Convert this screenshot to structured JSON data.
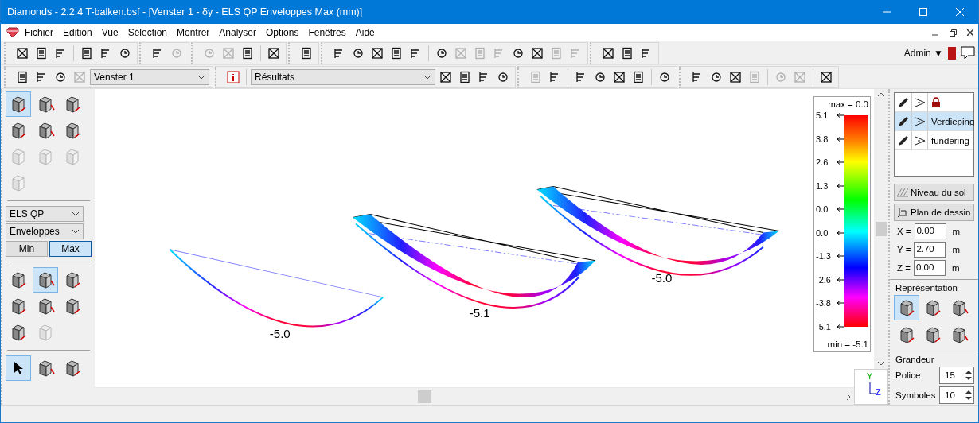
{
  "window": {
    "title": "Diamonds  -  2.2.4 T-balken.bsf - [Venster 1 - δy - ELS QP Enveloppes Max  (mm)]"
  },
  "menu": [
    {
      "label": "Fichier"
    },
    {
      "label": "Edition"
    },
    {
      "label": "Vue"
    },
    {
      "label": "Sélection"
    },
    {
      "label": "Montrer"
    },
    {
      "label": "Analyser"
    },
    {
      "label": "Options"
    },
    {
      "label": "Fenêtres"
    },
    {
      "label": "Aide"
    }
  ],
  "user": {
    "name": "Admin",
    "caret": "▼"
  },
  "toolbar_1": [
    [
      {
        "disabled": false
      },
      {
        "disabled": false
      },
      {
        "disabled": false
      }
    ],
    [
      {
        "disabled": false
      },
      {
        "disabled": false
      },
      {
        "disabled": false
      }
    ],
    [
      {
        "disabled": false
      },
      {
        "disabled": true
      }
    ],
    [
      {
        "disabled": true
      },
      {
        "disabled": true
      },
      {
        "disabled": false
      }
    ],
    [
      {
        "disabled": false
      }
    ],
    [
      {
        "disabled": false
      }
    ],
    [
      {
        "disabled": false
      },
      {
        "disabled": false
      },
      {
        "disabled": false
      },
      {
        "disabled": false
      },
      {
        "disabled": false
      }
    ],
    [
      {
        "disabled": false
      },
      {
        "disabled": true
      },
      {
        "disabled": true
      },
      {
        "disabled": true
      },
      {
        "disabled": false
      },
      {
        "disabled": false
      },
      {
        "disabled": true
      },
      {
        "disabled": true
      }
    ],
    [
      {
        "disabled": false
      },
      {
        "disabled": false
      },
      {
        "disabled": false
      }
    ]
  ],
  "toolbar_2": {
    "window_select": "Venster 1",
    "view_select": "Résultats",
    "groups_a": [
      [
        {
          "disabled": false
        },
        {
          "disabled": false
        },
        {
          "disabled": false
        },
        {
          "disabled": true
        }
      ]
    ],
    "groups_b": [
      [
        {
          "disabled": false
        },
        {
          "disabled": false
        },
        {
          "disabled": false
        },
        {
          "disabled": false
        }
      ],
      [
        {
          "disabled": true
        },
        {
          "disabled": false
        }
      ],
      [
        {
          "disabled": false
        },
        {
          "disabled": false
        },
        {
          "disabled": false
        },
        {
          "disabled": false
        }
      ],
      [
        {
          "disabled": false
        }
      ],
      [
        {
          "disabled": false
        },
        {
          "disabled": false
        },
        {
          "disabled": false
        },
        {
          "disabled": true
        }
      ],
      [
        {
          "disabled": true
        },
        {
          "disabled": true
        }
      ],
      [
        {
          "disabled": false
        }
      ]
    ]
  },
  "left_panel": {
    "result_tools": [
      {
        "selected": true,
        "disabled": false
      },
      {
        "selected": false,
        "disabled": false
      },
      {
        "selected": false,
        "disabled": false
      },
      {
        "selected": false,
        "disabled": false
      },
      {
        "selected": false,
        "disabled": false
      },
      {
        "selected": false,
        "disabled": false
      },
      {
        "selected": false,
        "disabled": true
      },
      {
        "selected": false,
        "disabled": true
      },
      {
        "selected": false,
        "disabled": true
      },
      {
        "selected": false,
        "disabled": true
      }
    ],
    "combination": "ELS QP",
    "mode": "Enveloppes",
    "extremes": [
      {
        "label": "Min",
        "selected": false
      },
      {
        "label": "Max",
        "selected": true
      }
    ],
    "components": [
      {
        "selected": false,
        "disabled": false
      },
      {
        "selected": true,
        "disabled": false
      },
      {
        "selected": false,
        "disabled": false
      },
      {
        "selected": false,
        "disabled": false
      },
      {
        "selected": false,
        "disabled": false
      },
      {
        "selected": false,
        "disabled": false
      },
      {
        "selected": false,
        "disabled": false
      },
      {
        "selected": false,
        "disabled": true
      }
    ],
    "tools": [
      {
        "selected": true
      },
      {
        "selected": false
      },
      {
        "selected": false
      }
    ]
  },
  "canvas": {
    "labels": [
      "-5.0",
      "-5.1",
      "-5.0"
    ]
  },
  "legend": {
    "max_label": "max = 0.0",
    "min_label": "min = -5.1",
    "ticks": [
      "5.1",
      "3.8",
      "2.6",
      "1.3",
      "0.0",
      "0.0",
      "-1.3",
      "-2.6",
      "-3.8",
      "-5.1"
    ]
  },
  "layers": [
    {
      "name": "Verdieping",
      "selected": true
    },
    {
      "name": "fundering",
      "selected": false
    }
  ],
  "drawing_plane": {
    "buttons": [
      "Niveau du sol",
      "Plan de dessin"
    ],
    "coords": [
      {
        "axis": "X =",
        "value": "0.00",
        "unit": "m"
      },
      {
        "axis": "Y =",
        "value": "2.70",
        "unit": "m"
      },
      {
        "axis": "Z =",
        "value": "0.00",
        "unit": "m"
      }
    ]
  },
  "representation": {
    "title": "Représentation",
    "modes": [
      {
        "selected": true
      },
      {
        "selected": false
      },
      {
        "selected": false
      },
      {
        "selected": false
      },
      {
        "selected": false
      },
      {
        "selected": false
      }
    ]
  },
  "size": {
    "title": "Grandeur",
    "fields": [
      {
        "label": "Police",
        "value": "15"
      },
      {
        "label": "Symboles",
        "value": "10"
      }
    ]
  },
  "axes": {
    "y": "Y",
    "z": "Z"
  }
}
